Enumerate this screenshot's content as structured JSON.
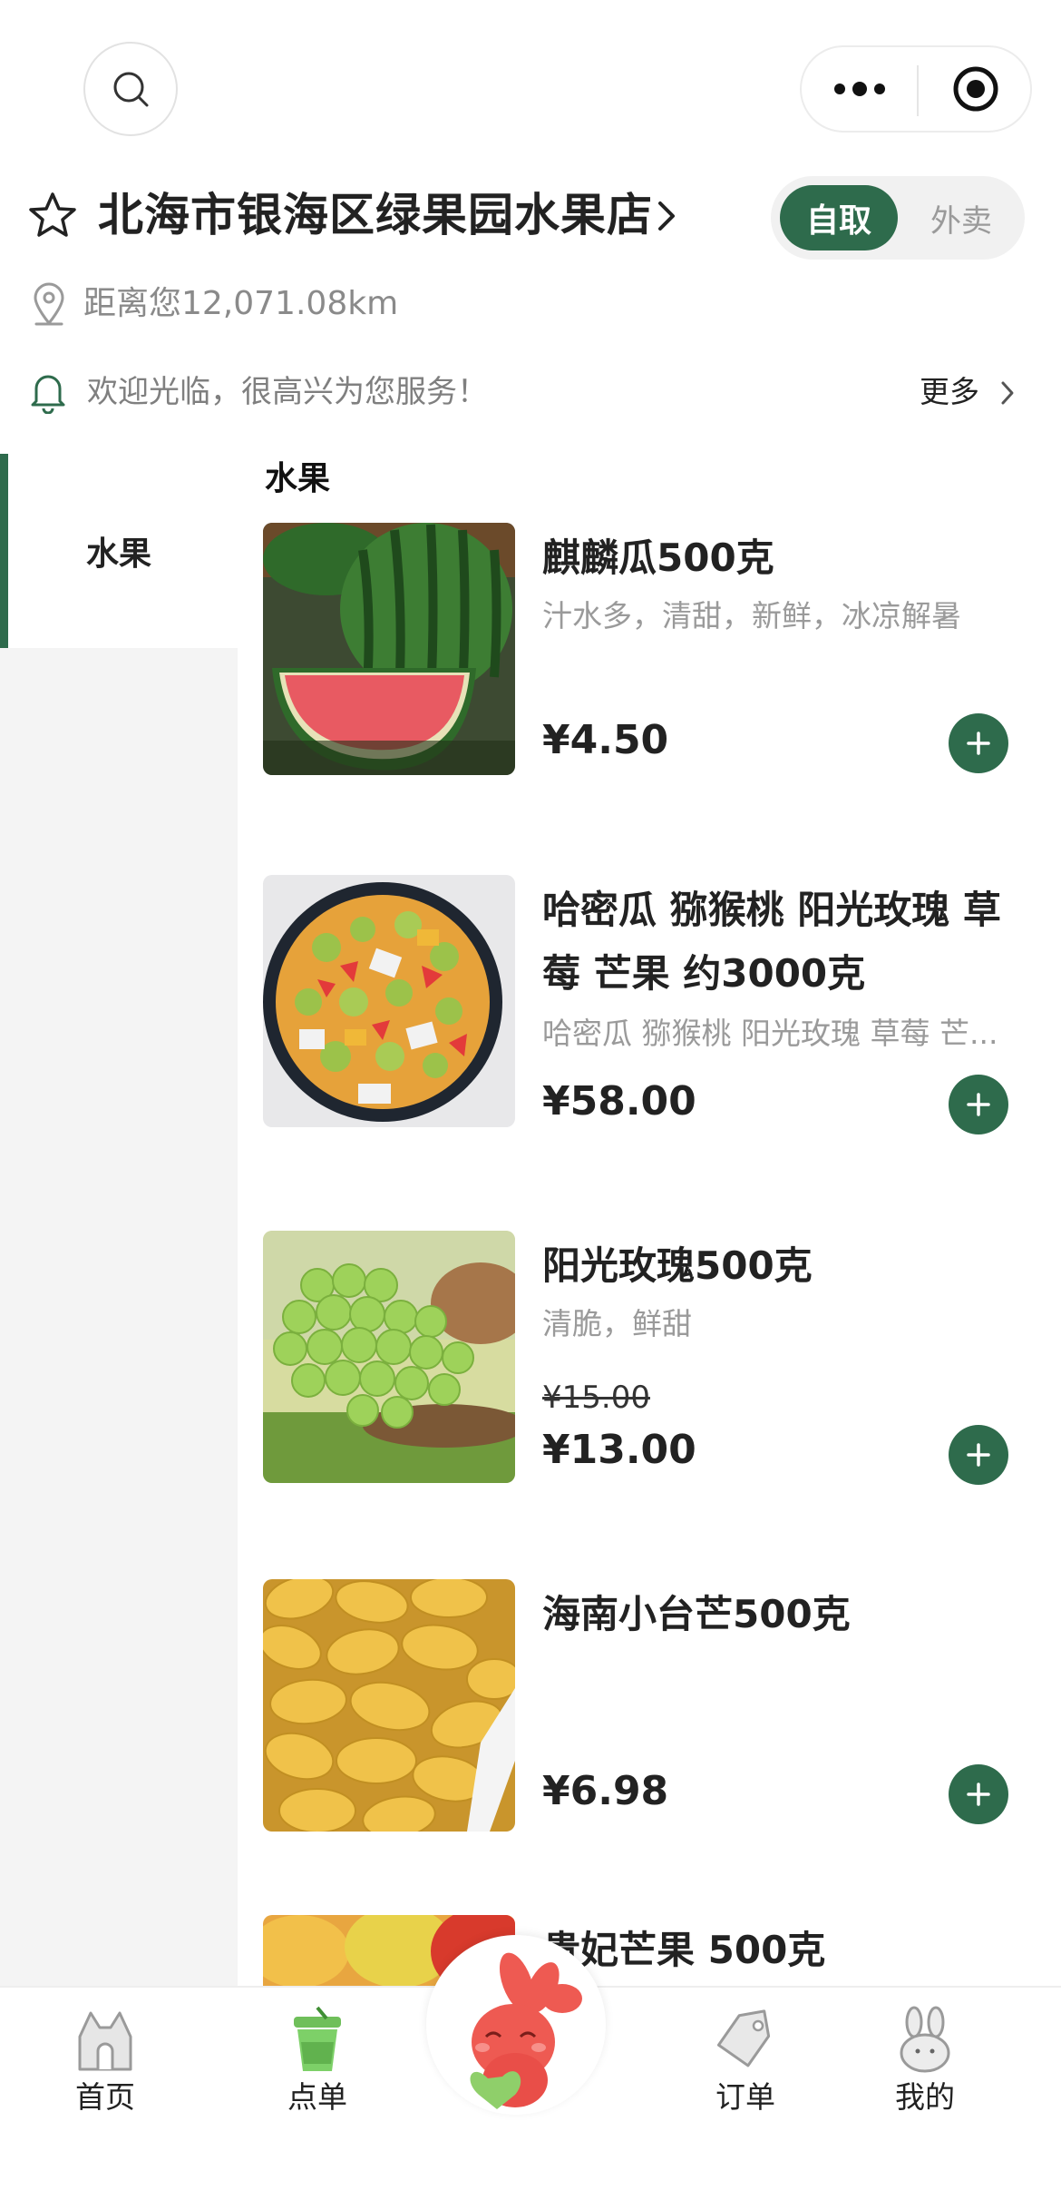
{
  "header": {
    "store_name": "北海市银海区绿果园水果店",
    "distance": "距离您12,071.08km",
    "notice": "欢迎光临，很高兴为您服务！",
    "more_label": "更多"
  },
  "mode_toggle": {
    "active": "自取",
    "inactive": "外卖"
  },
  "sidebar": {
    "items": [
      {
        "label": "水果"
      }
    ]
  },
  "section": {
    "title": "水果"
  },
  "products": [
    {
      "name": "麒麟瓜500克",
      "desc": "汁水多，清甜，新鲜，冰凉解暑",
      "price": "¥4.50"
    },
    {
      "name": "哈密瓜 猕猴桃 阳光玫瑰 草莓 芒果 约3000克",
      "desc": "哈密瓜 猕猴桃 阳光玫瑰 草莓 芒...",
      "price": "¥58.00"
    },
    {
      "name": "阳光玫瑰500克",
      "desc": "清脆，鲜甜",
      "original_price": "¥15.00",
      "price": "¥13.00"
    },
    {
      "name": "海南小台芒500克",
      "desc": "",
      "price": "¥6.98"
    },
    {
      "name": "贵妃芒果 500克"
    }
  ],
  "tabbar": {
    "home": "首页",
    "order_menu": "点单",
    "orders": "订单",
    "mine": "我的"
  },
  "colors": {
    "brand_green": "#2e6b4c",
    "sidebar_bg": "#f4f4f4"
  }
}
